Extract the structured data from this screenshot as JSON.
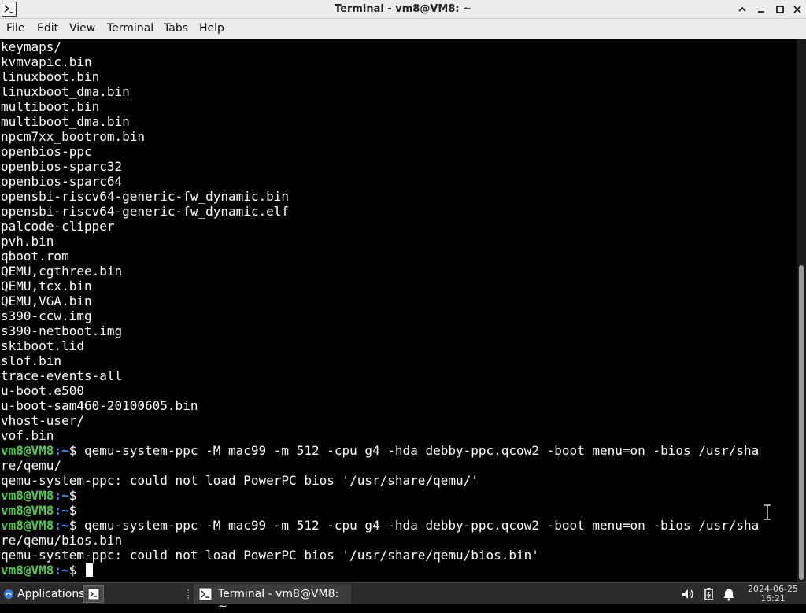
{
  "window": {
    "title": "Terminal - vm8@VM8: ~"
  },
  "menu": {
    "items": [
      "File",
      "Edit",
      "View",
      "Terminal",
      "Tabs",
      "Help"
    ]
  },
  "terminal": {
    "prompt_user": "vm8@VM8",
    "prompt_path": ":~",
    "prompt_symbol": "$",
    "output_lines": [
      "keymaps/",
      "kvmvapic.bin",
      "linuxboot.bin",
      "linuxboot_dma.bin",
      "multiboot.bin",
      "multiboot_dma.bin",
      "npcm7xx_bootrom.bin",
      "openbios-ppc",
      "openbios-sparc32",
      "openbios-sparc64",
      "opensbi-riscv64-generic-fw_dynamic.bin",
      "opensbi-riscv64-generic-fw_dynamic.elf",
      "palcode-clipper",
      "pvh.bin",
      "qboot.rom",
      "QEMU,cgthree.bin",
      "QEMU,tcx.bin",
      "QEMU,VGA.bin",
      "s390-ccw.img",
      "s390-netboot.img",
      "skiboot.lid",
      "slof.bin",
      "trace-events-all",
      "u-boot.e500",
      "u-boot-sam460-20100605.bin",
      "vhost-user/",
      "vof.bin"
    ],
    "session": [
      {
        "type": "prompt",
        "cmd": " qemu-system-ppc -M mac99 -m 512 -cpu g4 -hda debby-ppc.qcow2 -boot menu=on -bios /usr/sha"
      },
      {
        "type": "text",
        "text": "re/qemu/"
      },
      {
        "type": "text",
        "text": "qemu-system-ppc: could not load PowerPC bios '/usr/share/qemu/'"
      },
      {
        "type": "prompt",
        "cmd": ""
      },
      {
        "type": "prompt",
        "cmd": ""
      },
      {
        "type": "prompt",
        "cmd": " qemu-system-ppc -M mac99 -m 512 -cpu g4 -hda debby-ppc.qcow2 -boot menu=on -bios /usr/sha"
      },
      {
        "type": "text",
        "text": "re/qemu/bios.bin"
      },
      {
        "type": "text",
        "text": "qemu-system-ppc: could not load PowerPC bios '/usr/share/qemu/bios.bin'"
      },
      {
        "type": "prompt",
        "cmd": " ",
        "cursor": true
      }
    ],
    "colors": {
      "background": "#000000",
      "foreground": "#ffffff",
      "prompt_user": "#4ec94e",
      "prompt_path": "#5c8cff"
    }
  },
  "taskbar": {
    "applications_label": "Applications",
    "task_label": "Terminal - vm8@VM8: ~",
    "clock_date": "2024-06-25",
    "clock_time": "16:21",
    "tray_icons": [
      "volume-icon",
      "battery-icon",
      "notification-bell-icon"
    ]
  }
}
